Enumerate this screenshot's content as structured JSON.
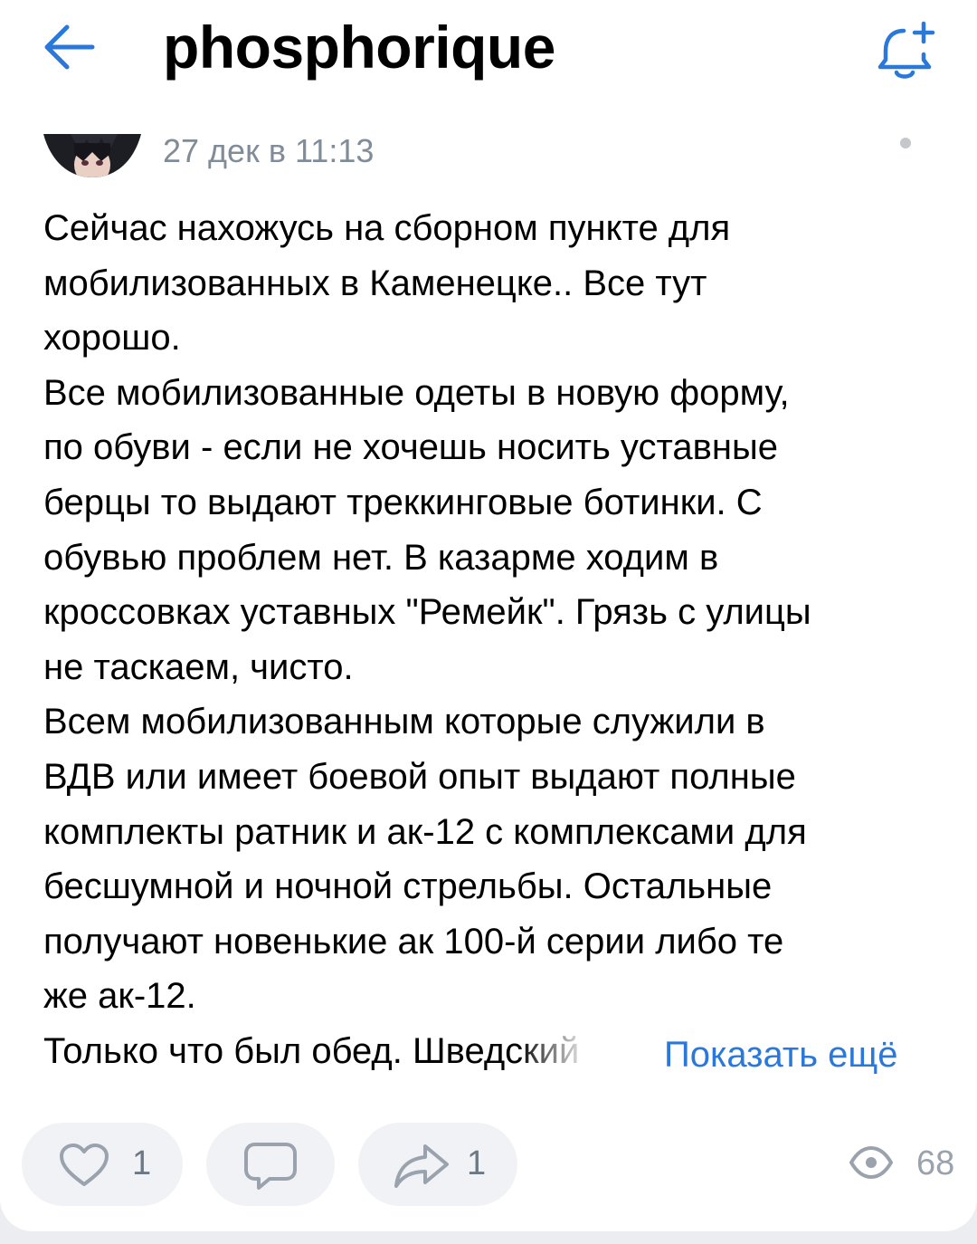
{
  "colors": {
    "accent": "#2a78d9",
    "secondary_text": "#818c99",
    "action_background": "#f0f2f5",
    "icon_gray": "#99a2ad"
  },
  "header": {
    "title": "phosphorique",
    "back_icon": "arrow-left-icon",
    "subscribe_icon": "bell-plus-icon"
  },
  "post": {
    "timestamp": "27 дек в 11:13",
    "menu_icon": "more-dot-icon",
    "lines": [
      "Сейчас нахожусь на сборном пункте для",
      "мобилизованных в Каменецке.. Все тут",
      "хорошо.",
      "Все мобилизованные одеты в новую форму,",
      "по обуви - если не хочешь носить уставные",
      "берцы то выдают треккинговые ботинки. С",
      "обувью проблем нет. В казарме ходим в",
      "кроссовках уставных \"Ремейк\". Грязь с улицы",
      "не таскаем, чисто.",
      "Всем мобилизованным которые служили в",
      "ВДВ или имеет боевой опыт выдают полные",
      "комплекты ратник и ак-12 с комплексами для",
      "бесшумной и ночной стрельбы. Остальные",
      "получают новенькие ак 100-й серии либо те",
      "же ак-12."
    ],
    "last_line_start": "Только что был обед. Шве",
    "last_line_fade": "дский",
    "show_more": "Показать ещё"
  },
  "actions": {
    "likes": "1",
    "shares": "1",
    "views": "68",
    "like_icon": "heart-icon",
    "comment_icon": "comment-icon",
    "share_icon": "share-arrow-icon",
    "views_icon": "eye-icon"
  }
}
